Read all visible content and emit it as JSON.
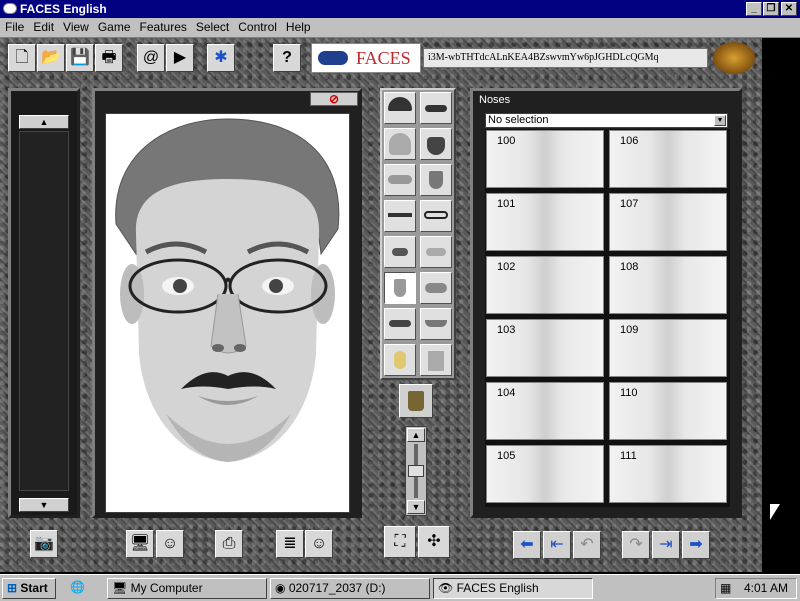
{
  "window": {
    "title": "FACES English"
  },
  "menu": [
    "File",
    "Edit",
    "View",
    "Game",
    "Features",
    "Select",
    "Control",
    "Help"
  ],
  "header": {
    "logo_text": "FACES",
    "code_text": "i3M-wbTHTdcALnKEA4BZswvmYw6pJGHDLcQGMq"
  },
  "features_panel": {
    "title": "Noses",
    "dropdown_value": "No selection",
    "noses": [
      "100",
      "106",
      "101",
      "107",
      "102",
      "108",
      "103",
      "109",
      "104",
      "110",
      "105",
      "111"
    ]
  },
  "taskbar": {
    "start_label": "Start",
    "tasks": [
      "My Computer",
      "020717_2037 (D:)",
      "FACES English"
    ],
    "clock": "4:01 AM"
  }
}
